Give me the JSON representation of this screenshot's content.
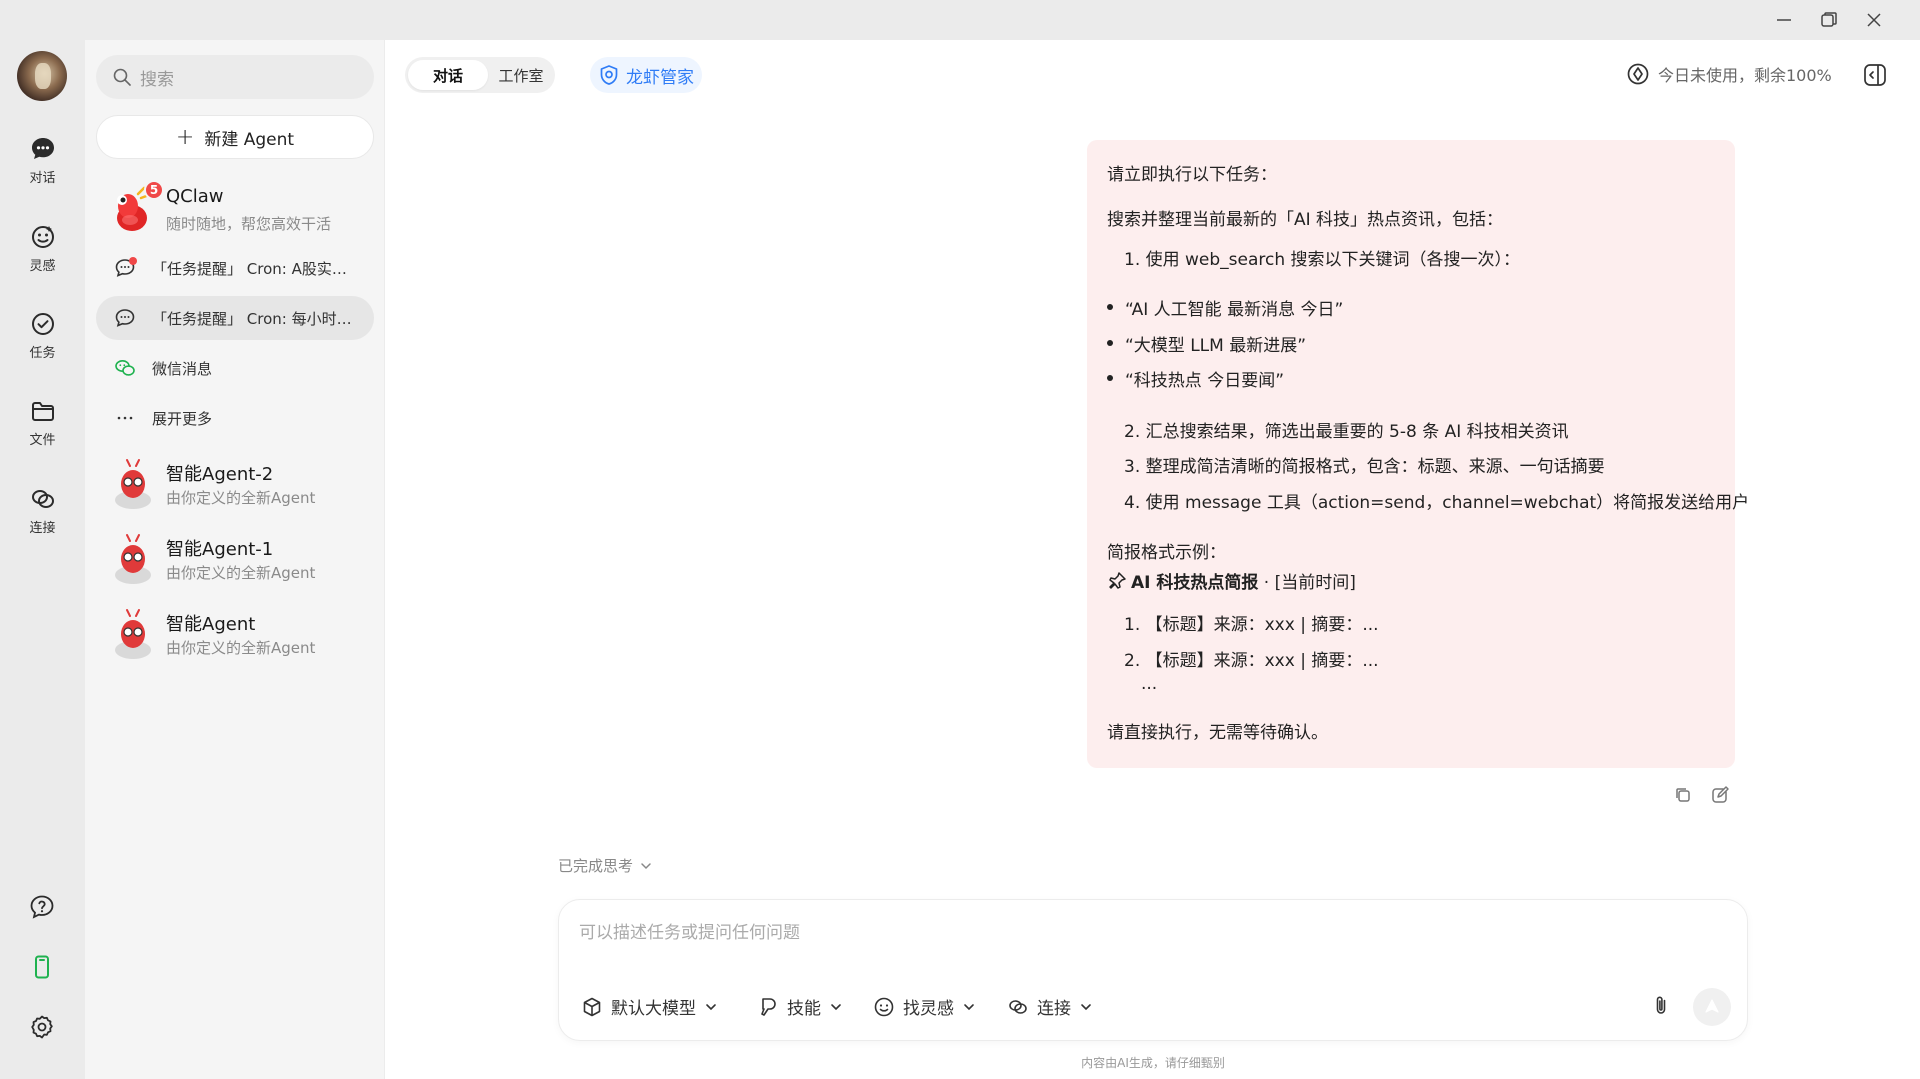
{
  "rail": {
    "items": [
      {
        "label": "对话",
        "icon": "chat-icon"
      },
      {
        "label": "灵感",
        "icon": "inspiration-icon"
      },
      {
        "label": "任务",
        "icon": "task-icon"
      },
      {
        "label": "文件",
        "icon": "folder-icon"
      },
      {
        "label": "连接",
        "icon": "link-icon"
      }
    ],
    "bottom_icons": [
      "help-icon",
      "phone-icon",
      "settings-icon"
    ],
    "phone_color": "#1fb24f"
  },
  "sidebar": {
    "search_placeholder": "搜索",
    "new_agent_label": "新建 Agent",
    "qclaw": {
      "name": "QClaw",
      "subtitle": "随时随地，帮您高效干活",
      "badge": "5"
    },
    "sub_items": [
      {
        "label": "「任务提醒」 Cron: A股实时市场复盘",
        "icon": "chat-bubble-icon",
        "unread": true
      },
      {
        "label": "「任务提醒」 Cron: 每小时 AI 科技热点简报",
        "icon": "chat-bubble-icon",
        "unread": false
      },
      {
        "label": "微信消息",
        "icon": "wechat-icon",
        "unread": false
      },
      {
        "label": "展开更多",
        "icon": "more-icon",
        "unread": false
      }
    ],
    "agents": [
      {
        "name": "智能Agent-2",
        "subtitle": "由你定义的全新Agent"
      },
      {
        "name": "智能Agent-1",
        "subtitle": "由你定义的全新Agent"
      },
      {
        "name": "智能Agent",
        "subtitle": "由你定义的全新Agent"
      }
    ]
  },
  "header": {
    "tabs": [
      "对话",
      "工作室"
    ],
    "active_tab": "对话",
    "guard_label": "龙虾管家",
    "usage_text": "今日未使用，剩余100%"
  },
  "message": {
    "l1": "请立即执行以下任务：",
    "l2": "搜索并整理当前最新的「AI 科技」热点资讯，包括：",
    "l3": "1. 使用 web_search 搜索以下关键词（各搜一次）：",
    "b1": "“AI 人工智能 最新消息 今日”",
    "b2": "“大模型 LLM 最新进展”",
    "b3": "“科技热点 今日要闻”",
    "l4": "2. 汇总搜索结果，筛选出最重要的 5-8 条 AI 科技相关资讯",
    "l5": "3. 整理成简洁清晰的简报格式，包含：标题、来源、一句话摘要",
    "l6": "4. 使用 message 工具（action=send，channel=webchat）将简报发送给用户",
    "l7": "简报格式示例：",
    "l8_bold": "AI 科技热点简报",
    "l8_rest": " · [当前时间]",
    "l9": "1. 【标题】来源：xxx | 摘要：...",
    "l10": "2. 【标题】来源：xxx | 摘要：...",
    "l11": "...",
    "l12": "请直接执行，无需等待确认。"
  },
  "thinking_label": "已完成思考",
  "composer": {
    "placeholder": "可以描述任务或提问任何问题",
    "tools": [
      "默认大模型",
      "技能",
      "找灵感",
      "连接"
    ]
  },
  "footnote": "内容由AI生成，请仔细甄别"
}
